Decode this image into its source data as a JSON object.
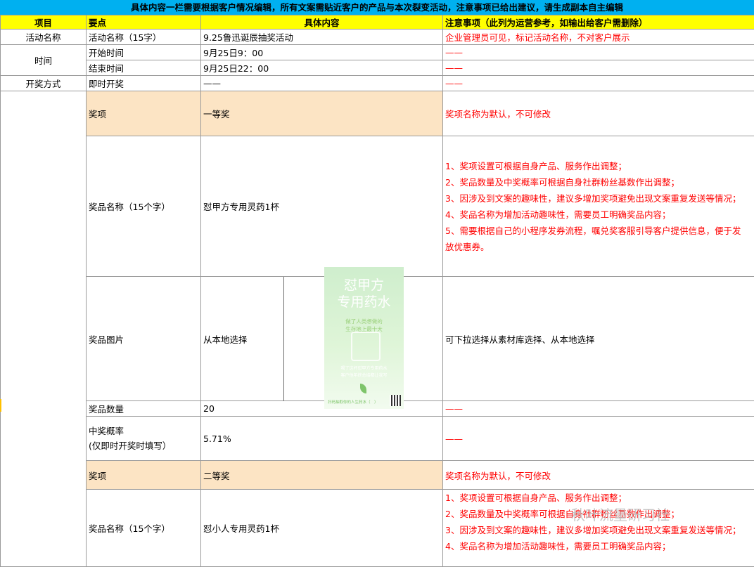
{
  "banner": "具体内容一栏需要根据客户情况编辑，所有文案需贴近客户的产品与本次裂变活动，注意事项已给出建议，请生成副本自主编辑",
  "headers": [
    "项目",
    "要点",
    "具体内容",
    "注意事项（此列为运营参考，如输出给客户需删除）"
  ],
  "rows": {
    "activity": {
      "item": "活动名称",
      "point": "活动名称（15字）",
      "content": "9.25鲁迅诞辰抽奖活动",
      "note": "企业管理员可见，标记活动名称，不对客户展示"
    },
    "time_label": "时间",
    "start": {
      "point": "开始时间",
      "content": "9月25日9：00",
      "note": "——"
    },
    "end": {
      "point": "结束时间",
      "content": "9月25日22：00",
      "note": "——"
    },
    "method": {
      "item": "开奖方式",
      "point": "即时开奖",
      "content": "——",
      "note": "——"
    },
    "prize1": {
      "point": "奖项",
      "content": "一等奖",
      "note": "奖项名称为默认，不可修改"
    },
    "prize_name1": {
      "point": "奖品名称（15个字）",
      "content": "怼甲方专用灵药1杯",
      "notes": [
        "1、奖项设置可根据自身产品、服务作出调整；",
        "2、奖品数量及中奖概率可根据自身社群粉丝基数作出调整；",
        "3、因涉及到文案的趣味性，建议多增加奖项避免出现文案重复发送等情况；",
        "4、奖品名称为增加活动趣味性，需要员工明确奖品内容；",
        "5、需要根据自己的小程序发券流程，嘱兑奖客服引导客户提供信息，便于发",
        "放优惠券。"
      ]
    },
    "prize_image": {
      "point": "奖品图片",
      "content": "从本地选择",
      "note": "可下拉选择从素材库选择、从本地选择"
    },
    "quantity": {
      "point": "奖品数量",
      "content": "20",
      "note": "——"
    },
    "probability": {
      "point_line1": "中奖概率",
      "point_line2": "(仅即时开奖时填写）",
      "content": "5.71%",
      "note": "——"
    },
    "prize2": {
      "point": "奖项",
      "content": "二等奖",
      "note": "奖项名称为默认，不可修改"
    },
    "prize_name2": {
      "point": "奖品名称（15个字）",
      "content": "怼小人专用灵药1杯",
      "notes": [
        "1、奖项设置可根据自身产品、服务作出调整；",
        "2、奖品数量及中奖概率可根据自身社群粉丝基数作出调整；",
        "3、因涉及到文案的趣味性，建议多增加奖项避免出现文案重复发送等情况；",
        "4、奖品名称为增加活动趣味性，需要员工明确奖品内容；"
      ]
    }
  },
  "poster": {
    "title_line1": "怼甲方",
    "title_line2": "专用药水",
    "sub_line1": "做了人类想做的",
    "sub_line2": "生存地上最十大",
    "tiny_line1": "喝了这杯怼甲方专用药水",
    "tiny_line2": "客户他年终总结都让我写",
    "footer": "扫码抽取你的人生药水（　）"
  },
  "watermark": "秋叶流量研习社"
}
